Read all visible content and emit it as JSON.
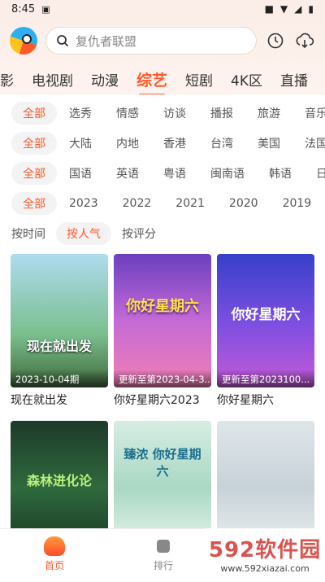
{
  "status": {
    "time": "8:45"
  },
  "search": {
    "placeholder": "复仇者联盟"
  },
  "nav_tabs": [
    {
      "label": "影"
    },
    {
      "label": "电视剧"
    },
    {
      "label": "动漫"
    },
    {
      "label": "综艺",
      "active": true
    },
    {
      "label": "短剧"
    },
    {
      "label": "4K区"
    },
    {
      "label": "直播"
    }
  ],
  "filters": {
    "type": [
      "全部",
      "选秀",
      "情感",
      "访谈",
      "播报",
      "旅游",
      "音乐"
    ],
    "region": [
      "全部",
      "大陆",
      "内地",
      "香港",
      "台湾",
      "美国",
      "法国"
    ],
    "language": [
      "全部",
      "国语",
      "英语",
      "粤语",
      "闽南语",
      "韩语",
      "日语"
    ],
    "year": [
      "全部",
      "2023",
      "2022",
      "2021",
      "2020",
      "2019"
    ]
  },
  "sort": [
    "按时间",
    "按人气",
    "按评分"
  ],
  "cards": [
    {
      "title": "现在就出发",
      "badge": "2023-10-04期",
      "poster_text": "现在就出发"
    },
    {
      "title": "你好星期六2023",
      "badge": "更新至第2023-04-3...",
      "poster_text": "你好星期六"
    },
    {
      "title": "你好星期六",
      "badge": "更新至第2023100...",
      "poster_text": "你好星期六"
    },
    {
      "title": "",
      "badge": "",
      "poster_text": "森林进化论"
    },
    {
      "title": "",
      "badge": "",
      "poster_text": "臻浓 你好星期六"
    },
    {
      "title": "",
      "badge": "",
      "poster_text": ""
    }
  ],
  "bottom_nav": [
    {
      "label": "首页"
    },
    {
      "label": "排行"
    }
  ],
  "watermark": {
    "line1": "592软件园",
    "line2": "www.592xiazai.com"
  },
  "colors": {
    "accent": "#ff5a2b"
  }
}
